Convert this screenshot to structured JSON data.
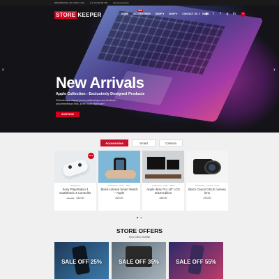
{
  "topbar": {
    "address": "9600 BRANDA, MI 9 PRO, USA",
    "phone": "(+1) 742 56 95 780",
    "email": "[email protected]"
  },
  "header": {
    "logo_part1": "STORE",
    "logo_part2": "KEEPER",
    "nav": [
      {
        "label": "HOME"
      },
      {
        "label": "ACCESSORIES",
        "badge": "NEW"
      },
      {
        "label": "SHOP ▾"
      },
      {
        "label": "SHOP ▾"
      },
      {
        "label": "CONTACT US"
      },
      {
        "label": "BLOG"
      }
    ],
    "icons": [
      "search-icon",
      "user-icon",
      "twitter-icon",
      "facebook-icon",
      "google-plus-icon",
      "linkedin-icon",
      "cart-icon"
    ]
  },
  "hero": {
    "title": "New Arrivals",
    "subtitle": "Apple Collection - Exclusively Designed Products",
    "text": "Pellentesque aliquet ipsum pellentesque sed tincidunt, urna fermentum felis, lorem nunc dignissim?",
    "button": "SHOP NOW",
    "prev_icon": "‹",
    "next_icon": "›"
  },
  "tabs": [
    {
      "label": "Accessories",
      "active": true
    },
    {
      "label": "Smart",
      "active": false
    },
    {
      "label": "Camera",
      "active": false
    }
  ],
  "products": [
    {
      "category": "Headphones",
      "name": "Sony PlayStation 4 DualShock 4 Controller",
      "old_price": "£21.00",
      "price": "£19.00",
      "sale": "SALE"
    },
    {
      "category": "Accessories · Smart · Tablet",
      "name": "Black-colored Smart Watch – Apple",
      "price": "£20.00"
    },
    {
      "category": "Accessories · Smart · Tablet",
      "name": "Apple iMac Pro 18\" LCD 2018 Edition",
      "price": "£45.00"
    },
    {
      "category": "Accessories · Camera · Smart",
      "name": "Black Canon DSLR camera lens",
      "price": "£78.00"
    }
  ],
  "offers": {
    "title": "STORE OFFERS",
    "subtitle": "Store Offers Subtitle",
    "items": [
      {
        "text": "SALE OFF 25%"
      },
      {
        "text": "SALE OFF 35%"
      },
      {
        "text": "SALE OFF 55%"
      }
    ]
  }
}
